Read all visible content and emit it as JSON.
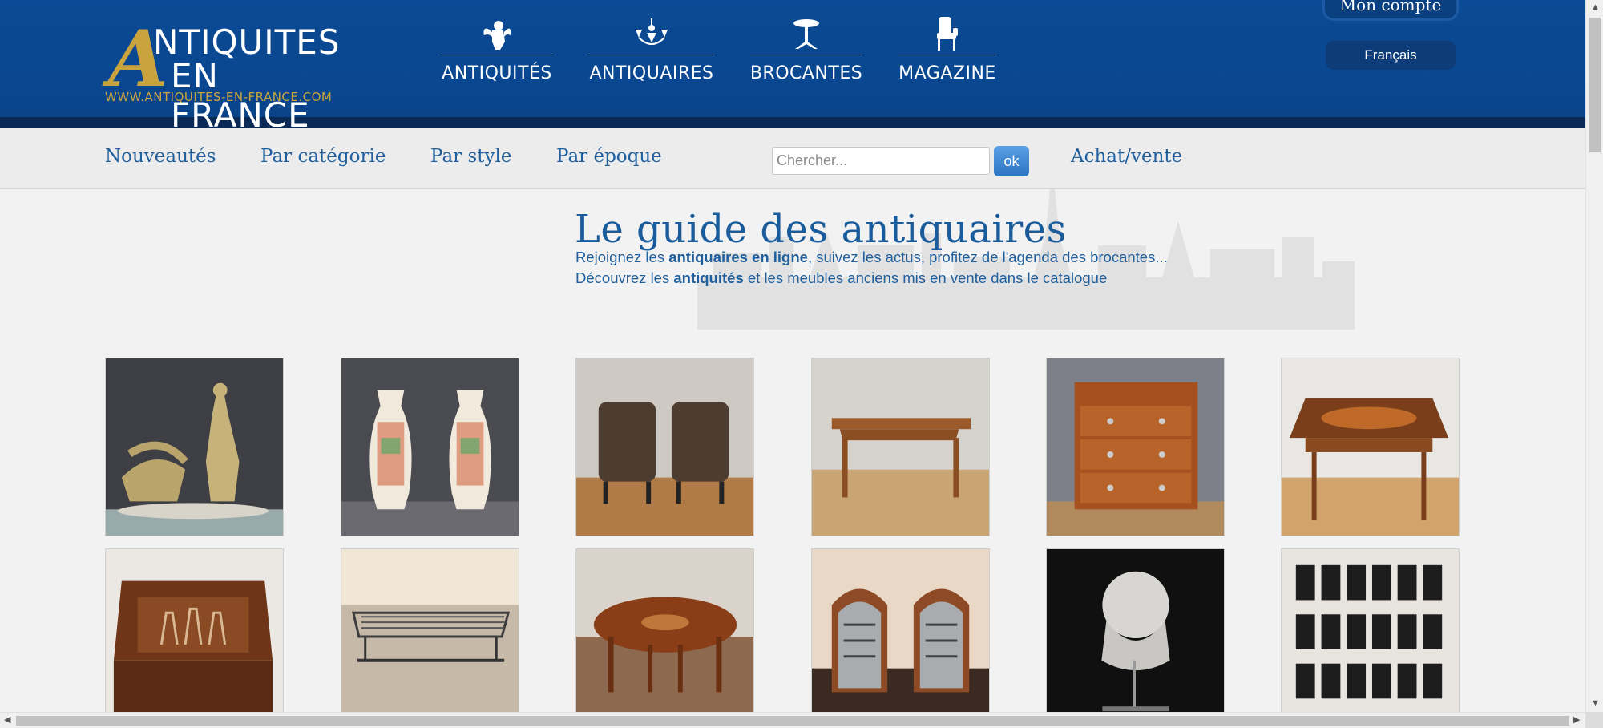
{
  "header": {
    "logo": {
      "letter": "A",
      "line1": "NTIQUITES",
      "line2": "EN FRANCE",
      "url": "WWW.ANTIQUITES-EN-FRANCE.COM"
    },
    "main_nav": [
      {
        "label": "ANTIQUITÉS",
        "icon": "cherub-icon"
      },
      {
        "label": "ANTIQUAIRES",
        "icon": "chandelier-icon"
      },
      {
        "label": "BROCANTES",
        "icon": "pedestal-table-icon"
      },
      {
        "label": "MAGAZINE",
        "icon": "armchair-icon"
      }
    ],
    "account_label": "Mon compte",
    "language_label": "Français"
  },
  "subnav": {
    "links": [
      "Nouveautés",
      "Par catégorie",
      "Par style",
      "Par époque"
    ],
    "search_placeholder": "Chercher...",
    "search_button": "ok",
    "buy_sell": "Achat/vente"
  },
  "hero": {
    "title": "Le guide des antiquaires",
    "line1_pre": "Rejoignez les ",
    "line1_bold": "antiquaires en ligne",
    "line1_post": ", suivez les actus, profitez de l'agenda des brocantes...",
    "line2_pre": "Découvrez les ",
    "line2_bold": "antiquités",
    "line2_post": " et les meubles anciens mis en vente dans le catalogue"
  },
  "products": [
    {
      "name": "art-deco-sculpture-lady-greyhounds"
    },
    {
      "name": "pair-canton-porcelain-vases"
    },
    {
      "name": "pair-leather-club-armchairs"
    },
    {
      "name": "louis-xv-writing-table"
    },
    {
      "name": "walnut-chest-of-drawers"
    },
    {
      "name": "inlaid-side-table"
    },
    {
      "name": "marquetry-box"
    },
    {
      "name": "chrome-wall-shelf"
    },
    {
      "name": "round-marquetry-table"
    },
    {
      "name": "pair-art-deco-bergeres"
    },
    {
      "name": "plaster-bust"
    },
    {
      "name": "framed-herbarium-set"
    }
  ],
  "colors": {
    "header_blue": "#0b4a94",
    "gold": "#c9a43e",
    "link_blue": "#1f5f9e",
    "title_blue": "#1a5c9b"
  }
}
